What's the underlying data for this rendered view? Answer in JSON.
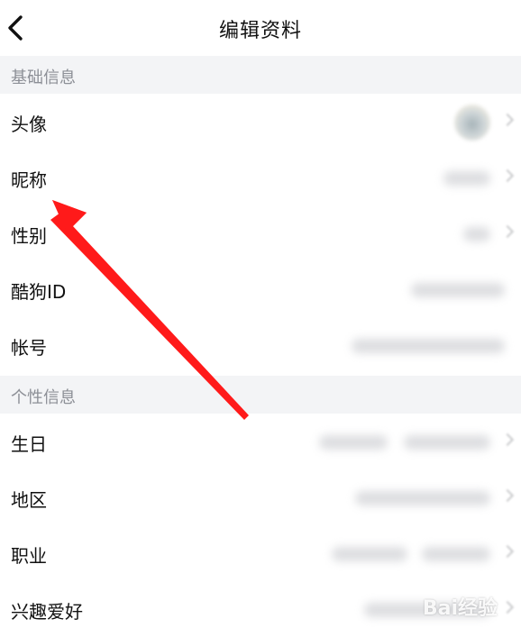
{
  "header": {
    "title": "编辑资料"
  },
  "sections": [
    {
      "title": "基础信息"
    },
    {
      "title": "个性信息"
    }
  ],
  "rows": [
    {
      "label": "头像"
    },
    {
      "label": "昵称"
    },
    {
      "label": "性别"
    },
    {
      "label": "酷狗ID"
    },
    {
      "label": "帐号"
    },
    {
      "label": "生日"
    },
    {
      "label": "地区"
    },
    {
      "label": "职业"
    },
    {
      "label": "兴趣爱好"
    }
  ],
  "icons": {
    "back": "chevron-left-icon",
    "arrow": "red-arrow-annotation",
    "watermark": "baidu-experience-watermark"
  },
  "colors": {
    "section_bg": "#f3f4f6",
    "section_text": "#8c8f96",
    "annotation_red": "#ff1a1a"
  },
  "watermark": {
    "text": "Bai经验"
  }
}
